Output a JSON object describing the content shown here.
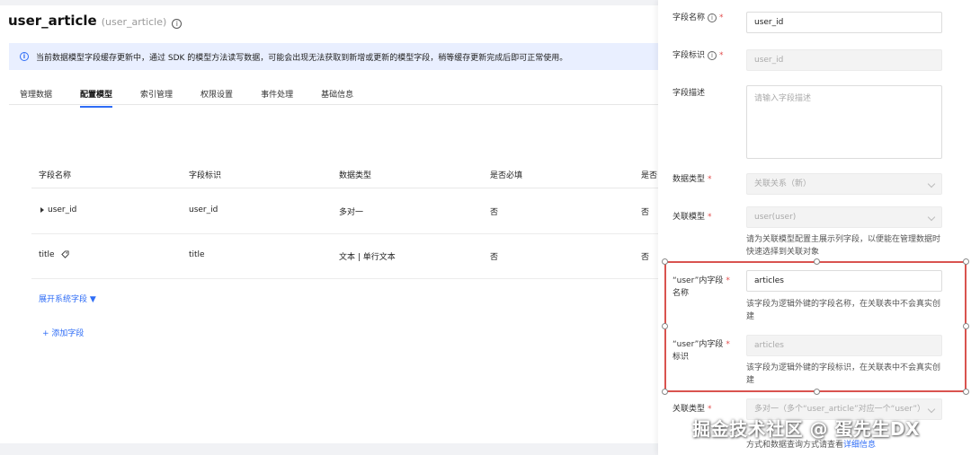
{
  "header": {
    "title": "user_article",
    "subtitle": "(user_article)",
    "info_icon": "info-icon"
  },
  "notice": {
    "icon": "info-icon",
    "text": "当前数据模型字段缓存更新中，通过 SDK 的模型方法读写数据，可能会出现无法获取到新增或更新的模型字段，稍等缓存更新完成后即可正常使用。"
  },
  "tabs": [
    {
      "label": "管理数据",
      "active": false
    },
    {
      "label": "配置模型",
      "active": true
    },
    {
      "label": "索引管理",
      "active": false
    },
    {
      "label": "权限设置",
      "active": false
    },
    {
      "label": "事件处理",
      "active": false
    },
    {
      "label": "基础信息",
      "active": false
    }
  ],
  "table": {
    "columns": [
      "字段名称",
      "字段标识",
      "数据类型",
      "是否必填",
      "是否"
    ],
    "rows": [
      {
        "name": "user_id",
        "key": "user_id",
        "type": "多对一",
        "required": "否",
        "extra": "否"
      },
      {
        "name": "title",
        "key": "title",
        "type": "文本 | 单行文本",
        "required": "否",
        "extra": "否"
      }
    ]
  },
  "actions": {
    "expand_system": "展开系统字段 ▼",
    "add_field": "+ 添加字段"
  },
  "drawer": {
    "field_name_label": "字段名称",
    "field_name_value": "user_id",
    "field_key_label": "字段标识",
    "field_key_value": "user_id",
    "field_desc_label": "字段描述",
    "field_desc_placeholder": "请输入字段描述",
    "data_type_label": "数据类型",
    "data_type_value": "关联关系（新）",
    "related_model_label": "关联模型",
    "related_model_value": "user(user)",
    "related_model_help": "请为关联模型配置主展示列字段，以便能在管理数据时快速选择到关联对象",
    "inner_name_label_1": "“user”内字段",
    "inner_name_label_2": "名称",
    "inner_name_value": "articles",
    "inner_name_help": "该字段为逻辑外键的字段名称，在关联表中不会真实创建",
    "inner_key_label_1": "“user”内字段",
    "inner_key_label_2": "标识",
    "inner_key_value": "articles",
    "inner_key_help": "该字段为逻辑外键的字段标识，在关联表中不会真实创建",
    "relation_type_label": "关联类型",
    "relation_type_value": "多对一（多个“user_article”对应一个“user”）",
    "relation_help_prefix": "方式和数据查询方式请查看",
    "relation_help_link": "详细信息"
  },
  "watermark": "掘金技术社区 @ 蛋先生DX",
  "colors": {
    "accent": "#2f6df6",
    "highlight": "#d9534f",
    "required": "#e34d4d"
  }
}
